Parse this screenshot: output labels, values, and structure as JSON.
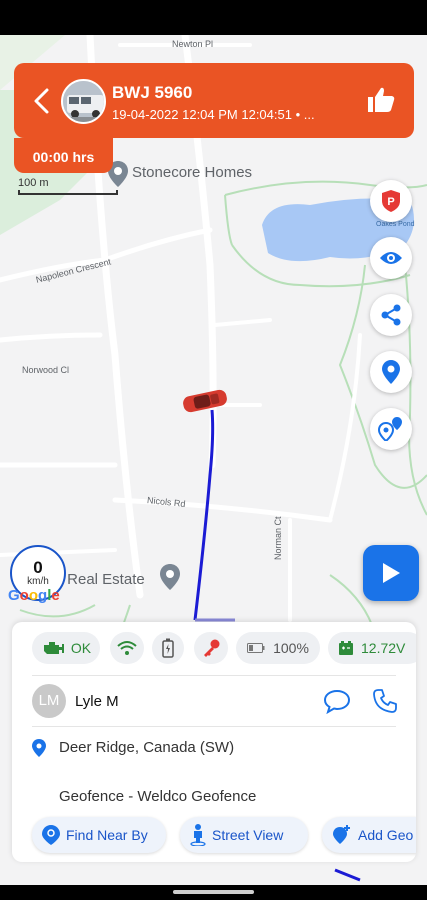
{
  "header": {
    "plate": "BWJ 5960",
    "timestamp": "19-04-2022 12:04 PM 12:04:51  •  ...",
    "duration": "00:00 hrs"
  },
  "map": {
    "scale_label": "100 m",
    "streets": {
      "newton": "Newton Pl",
      "napoleon": "Napoleon Crescent",
      "norwood": "Norwood Cl",
      "nicolls": "Nicols Rd",
      "norman": "Norman Ct",
      "oakes": "Oakes Pond"
    },
    "poi_stonecore": "Stonecore Homes",
    "poi_realestate": "r Real Estate",
    "google": "Google"
  },
  "speed": {
    "value": "0",
    "unit": "km/h"
  },
  "status": {
    "engine": "OK",
    "battery_pct": "100%",
    "voltage": "12.72V"
  },
  "driver": {
    "initials": "LM",
    "name": "Lyle M"
  },
  "location": "Deer Ridge, Canada (SW)",
  "geofence": "Geofence - Weldco Geofence",
  "actions": {
    "find_near_by": "Find Near By",
    "street_view": "Street View",
    "add_geofence": "Add Geo"
  },
  "colors": {
    "brand": "#ea5424",
    "accent": "#1a73e8",
    "route": "#1b1bd4",
    "ok_green": "#2e8b3a"
  },
  "icons": {
    "back": "chevron-left-icon",
    "like": "thumbs-up-icon",
    "parking": "parking-shield-icon",
    "visibility": "eye-icon",
    "share": "share-icon",
    "location": "map-pin-icon",
    "multi_location": "multi-pin-icon",
    "play": "play-icon",
    "engine": "engine-icon",
    "wifi": "wifi-icon",
    "battery_device": "battery-icon",
    "ignition": "key-icon",
    "battery_charge": "battery-level-icon",
    "voltage": "car-battery-icon",
    "chat": "chat-icon",
    "call": "phone-icon"
  }
}
